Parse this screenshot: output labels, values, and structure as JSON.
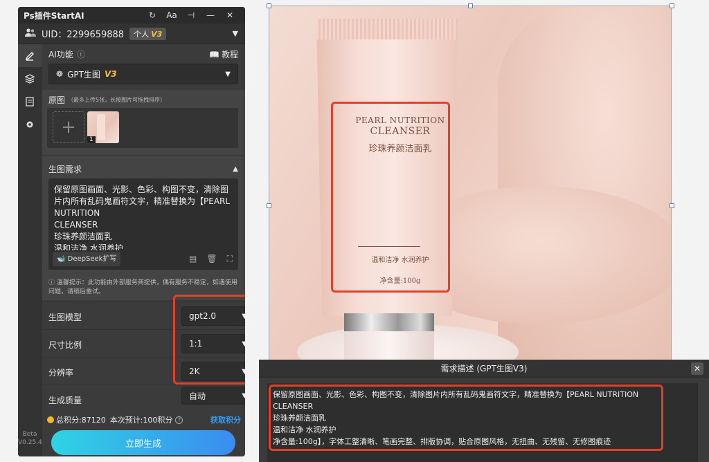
{
  "app": {
    "title": "Ps插件StartAI"
  },
  "titlebar": {
    "refresh_icon": "↻",
    "font_label": "Aa",
    "pin_icon": "📌",
    "minimize": "—",
    "close": "✕"
  },
  "user": {
    "uid": "UID：2299659888",
    "plan": "个人",
    "version": "V3"
  },
  "ai_function": {
    "label": "AI功能",
    "info": "ⓘ",
    "tutorial": "教程",
    "selected": "GPT生图",
    "version": "V3"
  },
  "source_images": {
    "label": "原图",
    "hint": "（最多上传5张，长按图片可拖拽排序）",
    "add": "+",
    "thumb_index": "1"
  },
  "requirement": {
    "label": "生图需求",
    "text": "保留原图画面、光影、色彩、构图不变，清除图片内所有乱码鬼画符文字，精准替换为【PEARL NUTRITION\nCLEANSER\n珍珠养颜洁面乳\n温和洁净 水润养护",
    "deepseek": "DeepSeek扩写"
  },
  "notice": "温馨提示：此功能由外部服务商提供，偶有服务不稳定，如遇使用问题，请稍后重试。",
  "params": [
    {
      "label": "生图模型",
      "value": "gpt2.0"
    },
    {
      "label": "尺寸比例",
      "value": "1:1"
    },
    {
      "label": "分辨率",
      "value": "2K"
    },
    {
      "label": "生成质量",
      "value": "自动"
    }
  ],
  "points": {
    "total": "总积分:87120",
    "estimate": "本次预计:100积分",
    "get": "获取积分"
  },
  "generate_button": "立即生成",
  "version_note": {
    "beta": "Beta",
    "ver": "V0.25.4"
  },
  "product": {
    "title_line1": "PEARL NUTRITION",
    "title_line2": "CLEANSER",
    "cn_name": "珍珠养颜洁面乳",
    "subtitle": "温和洁净  水润养护",
    "net": "净含量:100g"
  },
  "dialog": {
    "title": "需求描述 (GPT生图V3)",
    "close": "✕",
    "text": "保留原图画面、光影、色彩、构图不变，清除图片内所有乱码鬼画符文字，精准替换为【PEARL NUTRITION\nCLEANSER\n珍珠养颜洁面乳\n温和洁净 水润养护\n净含量:100g】，字体工整清晰、笔画完整、排版协调，贴合原图风格，无扭曲、无残留、无修图痕迹"
  },
  "colors": {
    "accent_start": "#2fd3e4",
    "accent_end": "#3a8cf0",
    "highlight": "#e0412b",
    "gold": "#f0c043",
    "link": "#2f9cf2"
  }
}
